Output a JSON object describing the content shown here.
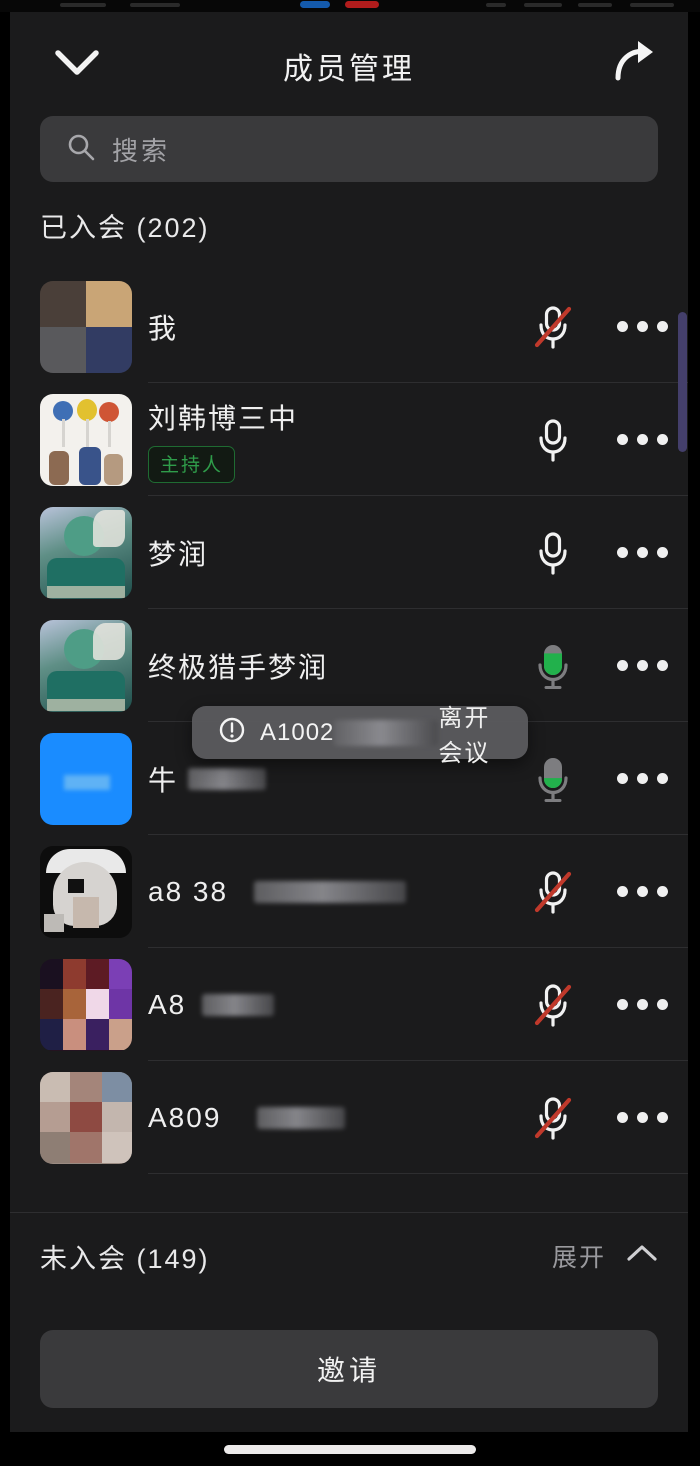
{
  "app": {
    "title": "成员管理",
    "back_icon": "chevron-down-icon",
    "share_icon": "share-icon"
  },
  "search": {
    "placeholder": "搜索",
    "value": "",
    "icon": "search-icon"
  },
  "joined_section": {
    "label": "已入会 (202)",
    "count": 202
  },
  "members": [
    {
      "name": "我",
      "name_suffix_blurred": false,
      "badge": "",
      "mic_state": "muted",
      "mic_level": 0,
      "avatar_kind": "pixelated-blocks",
      "avatar_colors": [
        "#4a3f39",
        "#c9a576",
        "#59595c",
        "#323c63"
      ],
      "more_icon": "more-dots-icon"
    },
    {
      "name": "刘韩博三中",
      "name_suffix_blurred": false,
      "badge": "主持人",
      "mic_state": "unmuted",
      "mic_level": 0,
      "avatar_kind": "balloons-photo",
      "avatar_colors": [
        "#f2f0ec",
        "#3f6fb5",
        "#e2c12f",
        "#cf5535"
      ],
      "more_icon": "more-dots-icon"
    },
    {
      "name": "梦润",
      "name_suffix_blurred": false,
      "badge": "",
      "mic_state": "unmuted",
      "mic_level": 0,
      "avatar_kind": "portrait-photo",
      "avatar_colors": [
        "#a8b4cf",
        "#2e7f6e",
        "#1d4d4a",
        "#c9c7b4"
      ],
      "more_icon": "more-dots-icon"
    },
    {
      "name": "终极猎手梦润",
      "name_suffix_blurred": false,
      "badge": "",
      "mic_state": "speaking",
      "mic_level": 72,
      "avatar_kind": "portrait-photo",
      "avatar_colors": [
        "#a8b4cf",
        "#2e7f6e",
        "#1d4d4a",
        "#c9c7b4"
      ],
      "more_icon": "more-dots-icon"
    },
    {
      "name": "牛",
      "name_suffix_blurred": true,
      "badge": "",
      "mic_state": "speaking",
      "mic_level": 33,
      "avatar_kind": "solid-blue",
      "avatar_colors": [
        "#1a8cff",
        "#5fb2f5",
        "#1a8cff",
        "#1a8cff"
      ],
      "more_icon": "more-dots-icon"
    },
    {
      "name": "a8 38",
      "name_suffix_blurred": true,
      "badge": "",
      "mic_state": "muted",
      "mic_level": 0,
      "avatar_kind": "pixelated-blocks",
      "avatar_colors": [
        "#d9d9d9",
        "#2b2b2b",
        "#b9b0a8",
        "#f0eeec"
      ],
      "more_icon": "more-dots-icon"
    },
    {
      "name": "A8",
      "name_suffix_blurred": true,
      "badge": "",
      "mic_state": "muted",
      "mic_level": 0,
      "avatar_kind": "pixelated-blocks",
      "avatar_colors": [
        "#3a1f28",
        "#8e3b2f",
        "#7b3fb5",
        "#2a2a55"
      ],
      "more_icon": "more-dots-icon"
    },
    {
      "name": "A809",
      "name_suffix_blurred": true,
      "badge": "",
      "mic_state": "muted",
      "mic_level": 0,
      "avatar_kind": "pixelated-blocks",
      "avatar_colors": [
        "#b8a59a",
        "#7d8ea3",
        "#8e4a42",
        "#cfc3bb"
      ],
      "more_icon": "more-dots-icon"
    }
  ],
  "toast": {
    "icon": "exclamation-circle-icon",
    "user": "A1002",
    "user_blurred": true,
    "action": "离开会议"
  },
  "not_joined_section": {
    "label": "未入会 (149)",
    "count": 149,
    "expand_label": "展开",
    "chevron_icon": "chevron-up-icon"
  },
  "invite_button": {
    "label": "邀请"
  },
  "colors": {
    "background": "#1b1b1c",
    "field": "#3a3a3c",
    "text": "#efefef",
    "muted_text": "#9a9a9e",
    "mic_muted_slash": "#c0392b",
    "mic_active_green": "#22b14c",
    "host_badge_green": "#2f9c4a",
    "scrollbar": "#443f6b"
  }
}
